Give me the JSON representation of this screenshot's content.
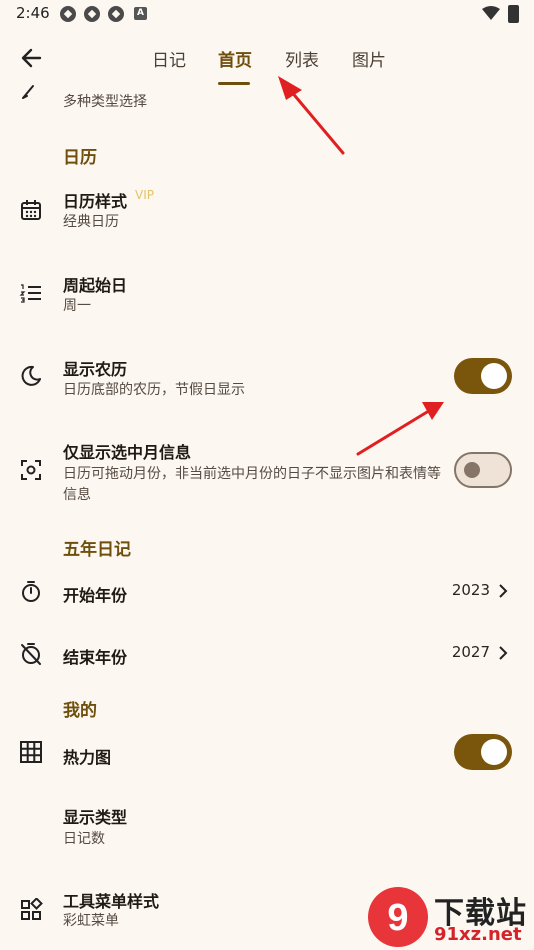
{
  "status_bar": {
    "time": "2:46",
    "a_glyph": "A"
  },
  "header": {
    "tabs": [
      {
        "label": "日记"
      },
      {
        "label": "首页"
      },
      {
        "label": "列表"
      },
      {
        "label": "图片"
      }
    ],
    "active_tab": "首页"
  },
  "top_partial": {
    "subtitle": "多种类型选择"
  },
  "sections": {
    "calendar": {
      "title": "日历",
      "calendar_style": {
        "title": "日历样式",
        "badge": "VIP",
        "subtitle": "经典日历"
      },
      "week_start": {
        "title": "周起始日",
        "subtitle": "周一"
      },
      "lunar": {
        "title": "显示农历",
        "subtitle": "日历底部的农历，节假日显示",
        "enabled": true
      },
      "only_selected_month": {
        "title": "仅显示选中月信息",
        "subtitle": "日历可拖动月份，非当前选中月份的日子不显示图片和表情等信息",
        "enabled": false
      }
    },
    "five_year": {
      "title": "五年日记",
      "start_year": {
        "title": "开始年份",
        "value": "2023"
      },
      "end_year": {
        "title": "结束年份",
        "value": "2027"
      }
    },
    "mine": {
      "title": "我的",
      "heatmap": {
        "title": "热力图",
        "enabled": true
      },
      "display_type": {
        "title": "显示类型",
        "subtitle": "日记数"
      },
      "toolbar_style": {
        "title": "工具菜单样式",
        "subtitle": "彩虹菜单"
      }
    }
  },
  "watermark": {
    "brand": "下载站",
    "url": "91xz.net",
    "logo_text": "9"
  },
  "colors": {
    "accent": "#6e4f0c",
    "toggle_on": "#7a560c",
    "vip": "#e2c565",
    "background": "#fdf7f2",
    "annotation": "#e02020"
  }
}
